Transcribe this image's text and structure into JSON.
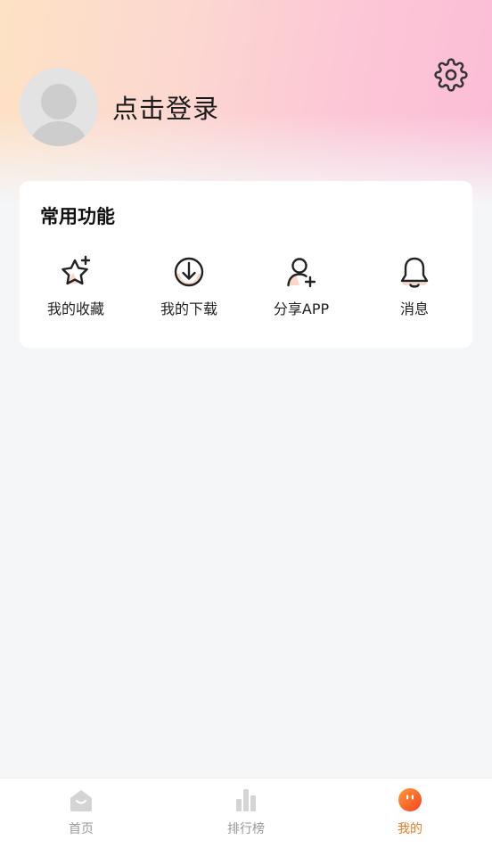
{
  "header": {
    "login_text": "点击登录"
  },
  "functions": {
    "title": "常用功能",
    "items": [
      {
        "label": "我的收藏",
        "icon": "star-icon"
      },
      {
        "label": "我的下载",
        "icon": "download-icon"
      },
      {
        "label": "分享APP",
        "icon": "add-user-icon"
      },
      {
        "label": "消息",
        "icon": "bell-icon"
      }
    ]
  },
  "tabbar": {
    "tabs": [
      {
        "label": "首页",
        "icon": "home-icon",
        "active": false
      },
      {
        "label": "排行榜",
        "icon": "bar-chart-icon",
        "active": false
      },
      {
        "label": "我的",
        "icon": "smiley-icon",
        "active": true
      }
    ]
  },
  "colors": {
    "accent": "#f2791f",
    "inactive": "#999999",
    "icon_highlight": "#f8d8c8"
  }
}
